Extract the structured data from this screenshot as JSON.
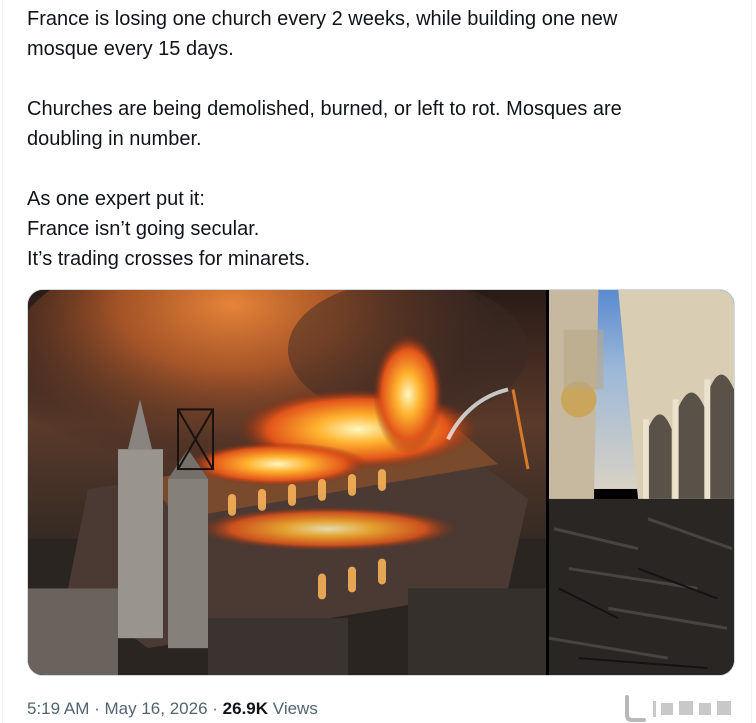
{
  "tweet": {
    "paragraphs": [
      [
        "France is losing one church every 2 weeks, while building one new",
        "mosque every 15 days."
      ],
      [
        "Churches are being demolished, burned, or left to rot. Mosques are",
        "doubling in number."
      ],
      [
        "As one expert put it:",
        "France isn’t going secular.",
        "It’s trading crosses for minarets."
      ]
    ]
  },
  "media": {
    "left_image": "burning-church-aerial-photo",
    "right_image": "burned-church-interior-photo"
  },
  "meta": {
    "time": "5:19 AM",
    "separator": "·",
    "date": "May 16, 2026",
    "views_count": "26.9K",
    "views_label": "Views"
  }
}
